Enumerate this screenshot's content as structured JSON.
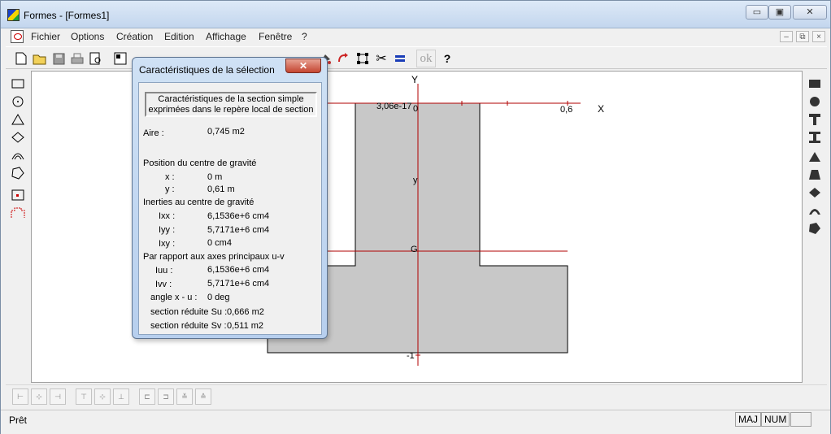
{
  "app": {
    "title": "Formes - [Formes1]",
    "window_buttons": {
      "minimize": "▭",
      "maximize": "▣",
      "close": "✕"
    }
  },
  "menu": {
    "items": [
      "Fichier",
      "Options",
      "Création",
      "Edition",
      "Affichage",
      "Fenêtre",
      "?"
    ],
    "mdi_buttons": {
      "minimize": "–",
      "restore": "⧉",
      "close": "×"
    }
  },
  "toolbar": {
    "ok_label": "ok",
    "help_label": "?"
  },
  "canvas": {
    "x_axis_label": "X",
    "y_axis_label": "Y",
    "tick_left": "3,06e-17",
    "tick_origin": "0",
    "tick_right": "0,6",
    "small_y_label": "y",
    "g_label": "G",
    "bottom_label": "-1"
  },
  "status": {
    "text": "Prêt",
    "maj": "MAJ",
    "num": "NUM"
  },
  "dialog": {
    "title": "Caractéristiques de la sélection",
    "close": "✕",
    "header_line1": "Caractéristiques de la section simple",
    "header_line2": "exprimées dans le repère local de section",
    "aire_label": "Aire :",
    "aire_value": "0,745  m2",
    "position_heading": "Position du centre de gravité",
    "x_label": "x :",
    "x_value": "0  m",
    "y_label": "y :",
    "y_value": "0,61  m",
    "inerties_heading": "Inerties au centre de gravité",
    "ixx_label": "Ixx :",
    "ixx_value": "6,1536e+6  cm4",
    "iyy_label": "Iyy :",
    "iyy_value": "5,7171e+6  cm4",
    "ixy_label": "Ixy :",
    "ixy_value": "0  cm4",
    "principal_heading": "Par rapport aux axes principaux u-v",
    "iuu_label": "Iuu :",
    "iuu_value": "6,1536e+6  cm4",
    "ivv_label": "Ivv :",
    "ivv_value": "5,7171e+6  cm4",
    "angle_label": "angle x - u :",
    "angle_value": "0  deg",
    "su_label": "section réduite Su :",
    "su_value": "0,666  m2",
    "sv_label": "section réduite Sv :",
    "sv_value": "0,511  m2"
  }
}
